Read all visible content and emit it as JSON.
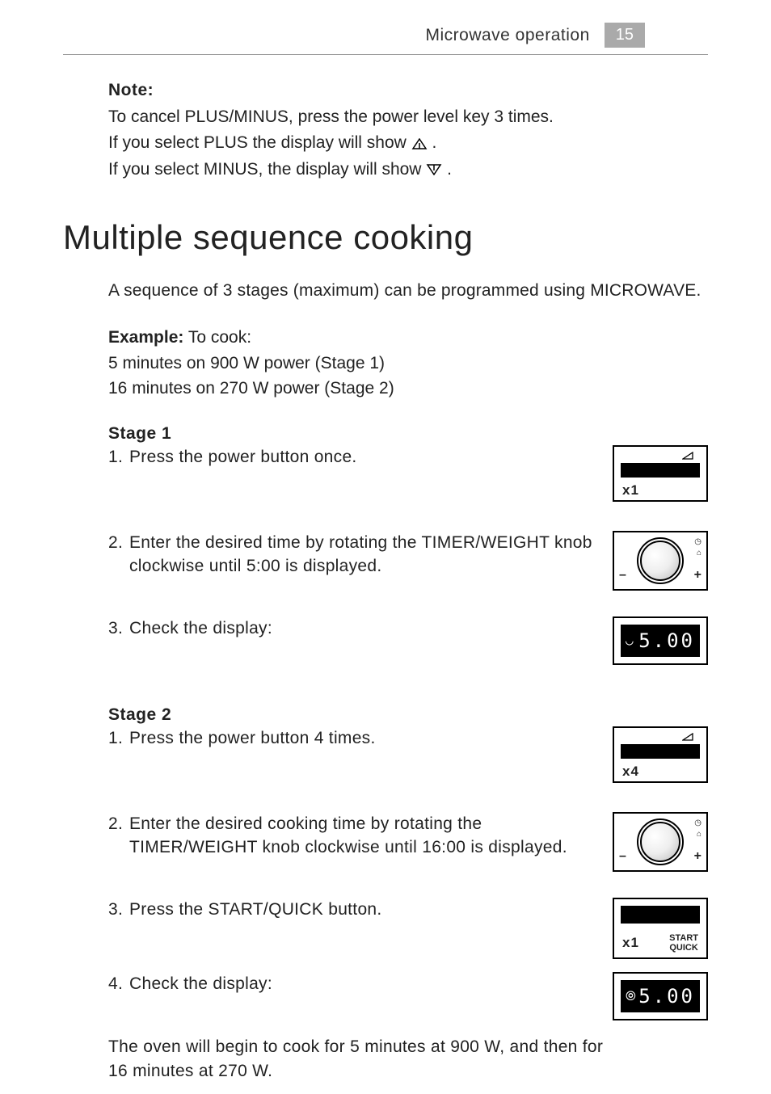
{
  "header": {
    "title": "Microwave operation",
    "page": "15"
  },
  "note": {
    "label": "Note:",
    "line1": "To cancel PLUS/MINUS, press the power level key 3 times.",
    "line2a": "If you select PLUS the display will show ",
    "line2b": " .",
    "line3a": "If you select MINUS, the display will show ",
    "line3b": "."
  },
  "section_title": "Multiple sequence cooking",
  "intro": "A sequence of 3 stages (maximum) can be programmed using MICROWAVE.",
  "example": {
    "label": "Example:",
    "after_label": " To cook:",
    "line1": "5 minutes on 900 W power   (Stage 1)",
    "line2": "16 minutes on 270 W power (Stage 2)"
  },
  "stage1": {
    "title": "Stage 1",
    "s1_num": "1.",
    "s1_text": "Press the power button once.",
    "s2_num": "2.",
    "s2_text": "Enter the desired time by rotating the TIMER/WEIGHT knob clockwise until 5:00 is displayed.",
    "s3_num": "3.",
    "s3_text": "Check the display:"
  },
  "stage2": {
    "title": "Stage 2",
    "s1_num": "1.",
    "s1_text": "Press the power button 4 times.",
    "s2_num": "2.",
    "s2_text": "Enter the desired cooking time by rotating the TIMER/WEIGHT knob clockwise until 16:00 is displayed.",
    "s3_num": "3.",
    "s3_text": "Press the START/QUICK button.",
    "s4_num": "4.",
    "s4_text": "Check the display:"
  },
  "panels": {
    "x1": "x1",
    "x4": "x4",
    "minus": "–",
    "plus": "+",
    "lcd_500": "5.00",
    "start": "START",
    "quick": "QUICK"
  },
  "final": {
    "line1": "The oven will begin to cook for 5 minutes at 900 W, and then for",
    "line2": "16 minutes at 270 W."
  }
}
